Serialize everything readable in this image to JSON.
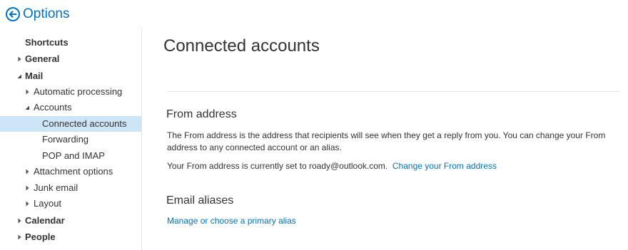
{
  "header": {
    "title": "Options",
    "back_icon": "arrow-left-circle-icon",
    "accent": "#0072c6"
  },
  "sidebar": {
    "selected_color": "#cde6f7",
    "items": [
      {
        "label": "Shortcuts",
        "bold": true,
        "level": 0,
        "expander": "none"
      },
      {
        "label": "General",
        "bold": true,
        "level": 0,
        "expander": "collapsed"
      },
      {
        "label": "Mail",
        "bold": true,
        "level": 0,
        "expander": "expanded"
      },
      {
        "label": "Automatic processing",
        "bold": false,
        "level": 1,
        "expander": "collapsed"
      },
      {
        "label": "Accounts",
        "bold": false,
        "level": 1,
        "expander": "expanded"
      },
      {
        "label": "Connected accounts",
        "bold": false,
        "level": 2,
        "expander": "none",
        "selected": true
      },
      {
        "label": "Forwarding",
        "bold": false,
        "level": 2,
        "expander": "none"
      },
      {
        "label": "POP and IMAP",
        "bold": false,
        "level": 2,
        "expander": "none"
      },
      {
        "label": "Attachment options",
        "bold": false,
        "level": 1,
        "expander": "collapsed"
      },
      {
        "label": "Junk email",
        "bold": false,
        "level": 1,
        "expander": "collapsed"
      },
      {
        "label": "Layout",
        "bold": false,
        "level": 1,
        "expander": "collapsed"
      },
      {
        "label": "Calendar",
        "bold": true,
        "level": 0,
        "expander": "collapsed"
      },
      {
        "label": "People",
        "bold": true,
        "level": 0,
        "expander": "collapsed"
      }
    ]
  },
  "main": {
    "title": "Connected accounts",
    "from_section": {
      "title": "From address",
      "description": "The From address is the address that recipients will see when they get a reply from you. You can change your From address to any connected account or an alias.",
      "current_text": "Your From address is currently set to roady@outlook.com.",
      "change_link": "Change your From address"
    },
    "aliases_section": {
      "title": "Email aliases",
      "manage_link": "Manage or choose a primary alias"
    }
  }
}
